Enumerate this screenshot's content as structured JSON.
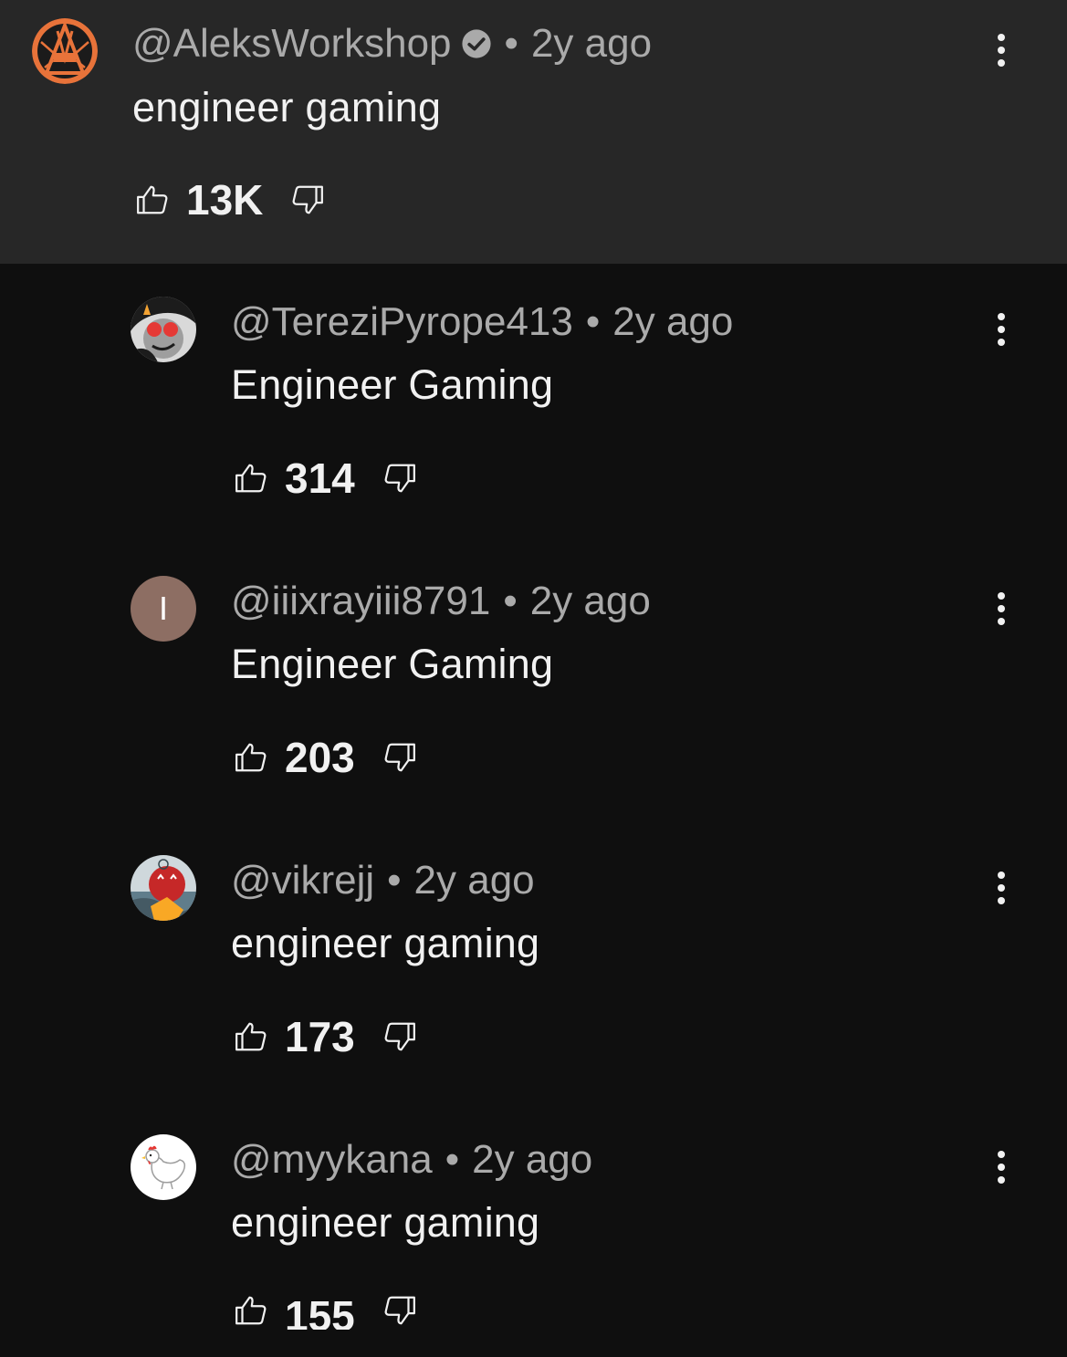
{
  "comments": [
    {
      "handle": "@AleksWorkshop",
      "time": "2y ago",
      "verified": true,
      "text": "engineer gaming",
      "likes": "13K",
      "avatar": "aleksworkshop-logo"
    },
    {
      "handle": "@TereziPyrope413",
      "time": "2y ago",
      "text": "Engineer Gaming",
      "likes": "314",
      "avatar": "terezi-character"
    },
    {
      "handle": "@iiixrayiii8791",
      "time": "2y ago",
      "text": "Engineer Gaming",
      "likes": "203",
      "avatar": "letter-avatar",
      "avatar_letter": "I",
      "avatar_color": "#8d6e63"
    },
    {
      "handle": "@vikrejj",
      "time": "2y ago",
      "text": "engineer gaming",
      "likes": "173",
      "avatar": "red-character"
    },
    {
      "handle": "@myykana",
      "time": "2y ago",
      "text": "engineer gaming",
      "likes": "155",
      "avatar": "chicken"
    }
  ],
  "separator": "•",
  "colors": {
    "background": "#0f0f0f",
    "highlight": "#272727",
    "text": "#f1f1f1",
    "secondary": "#aaaaaa"
  }
}
